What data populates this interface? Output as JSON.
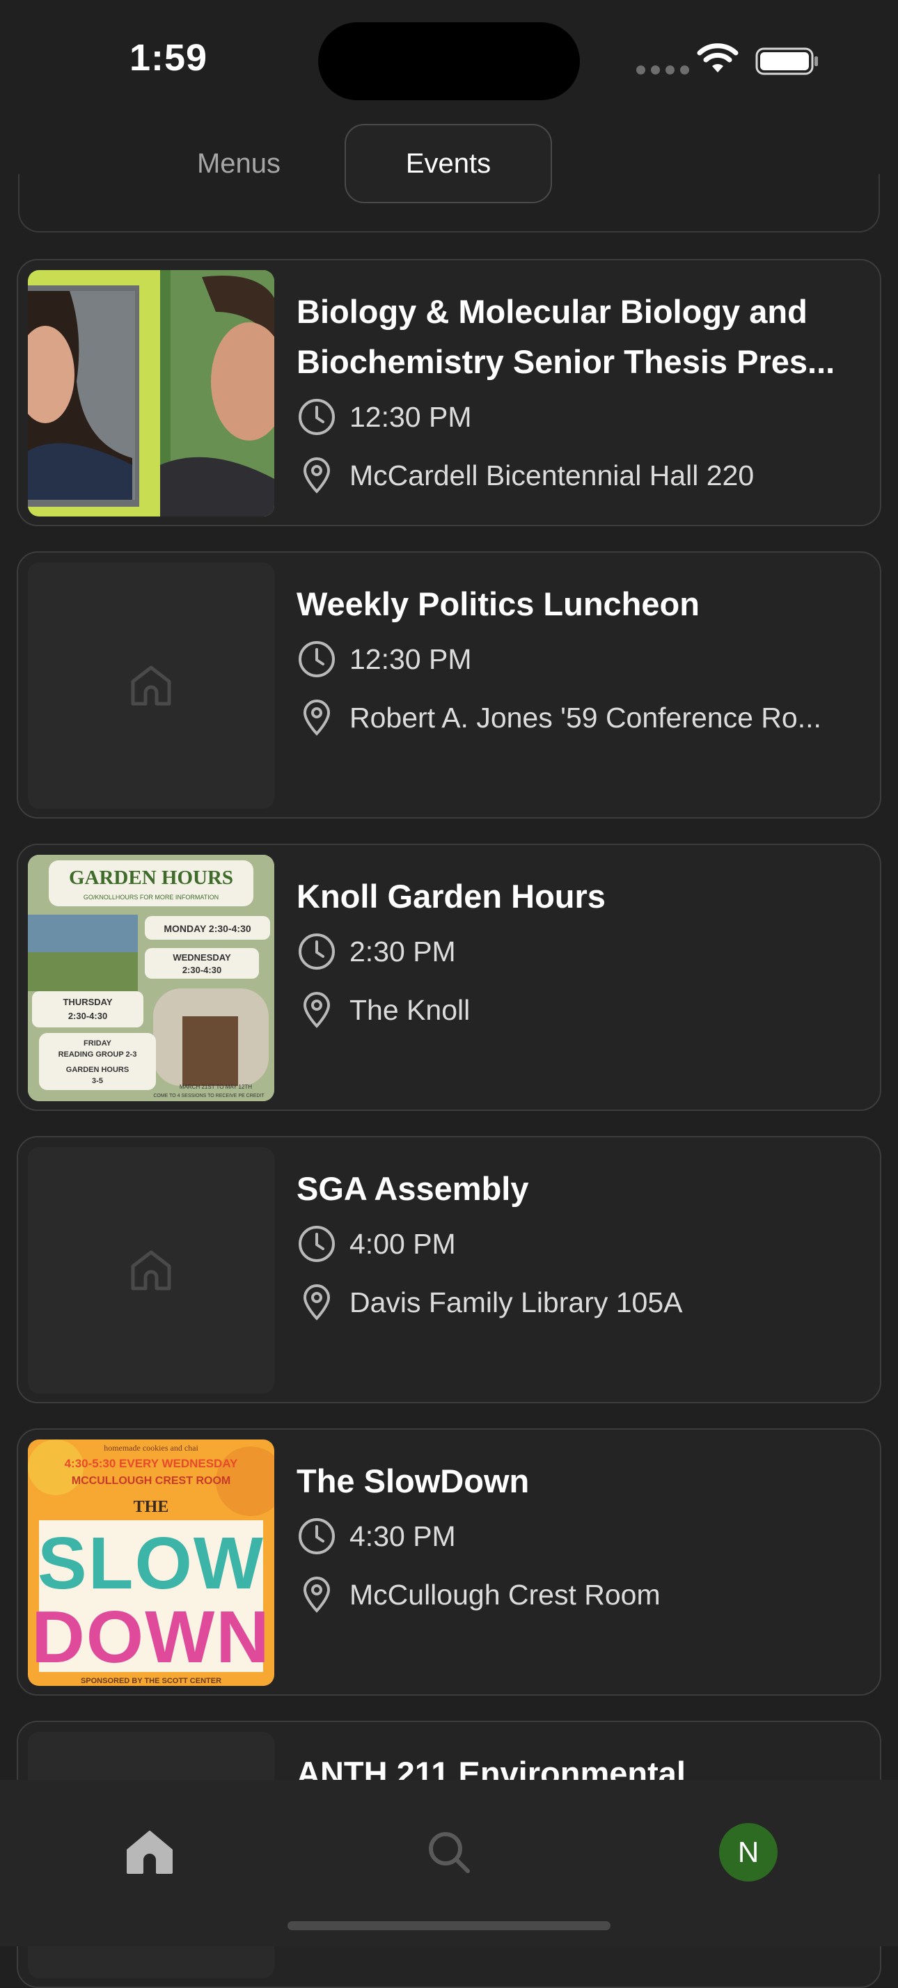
{
  "status": {
    "time": "1:59"
  },
  "segments": {
    "menus": "Menus",
    "events": "Events",
    "selected": "Events"
  },
  "events": [
    {
      "title": "Biology & Molecular Biology and Biochemistry Senior Thesis Pres...",
      "time": "12:30 PM",
      "location": "McCardell Bicentennial Hall 220",
      "image": "photo-two-students"
    },
    {
      "title": "Weekly Politics Luncheon",
      "time": "12:30 PM",
      "location": "Robert A. Jones '59 Conference Ro...",
      "image": "placeholder-home-icon"
    },
    {
      "title": "Knoll Garden Hours",
      "time": "2:30 PM",
      "location": "The Knoll",
      "image": "garden-hours-flyer"
    },
    {
      "title": "SGA Assembly",
      "time": "4:00 PM",
      "location": "Davis Family Library 105A",
      "image": "placeholder-home-icon"
    },
    {
      "title": "The SlowDown",
      "time": "4:30 PM",
      "location": "McCullough Crest Room",
      "image": "slowdown-flyer"
    },
    {
      "title": "ANTH 211 Environmental",
      "time": "",
      "location": "",
      "image": "placeholder-home-icon"
    }
  ],
  "flyers": {
    "garden": {
      "title": "GARDEN HOURS",
      "subtitle": "GO/KNOLLHOURS FOR MORE INFORMATION",
      "monday": "MONDAY 2:30-4:30",
      "wednesday_label": "WEDNESDAY",
      "wednesday_time": "2:30-4:30",
      "thursday_label": "THURSDAY",
      "thursday_time": "2:30-4:30",
      "friday_label": "FRIDAY",
      "friday_group": "READING GROUP 2-3",
      "hours_label": "GARDEN HOURS",
      "hours_time": "3-5",
      "footer1": "MARCH 21ST TO MAY 12TH",
      "footer2": "COME TO 4 SESSIONS TO RECEIVE PE CREDIT"
    },
    "slowdown": {
      "top": "homemade cookies and chai",
      "time": "4:30-5:30 EVERY WEDNESDAY",
      "room": "MCCULLOUGH CREST ROOM",
      "the": "THE",
      "word1": "SLOW",
      "word2": "DOWN",
      "bottom": "SPONSORED BY THE SCOTT CENTER"
    }
  },
  "tabbar": {
    "avatar_initial": "N",
    "active_tab": "home"
  },
  "colors": {
    "background": "#202020",
    "card": "#242424",
    "avatar": "#2d6b22"
  }
}
